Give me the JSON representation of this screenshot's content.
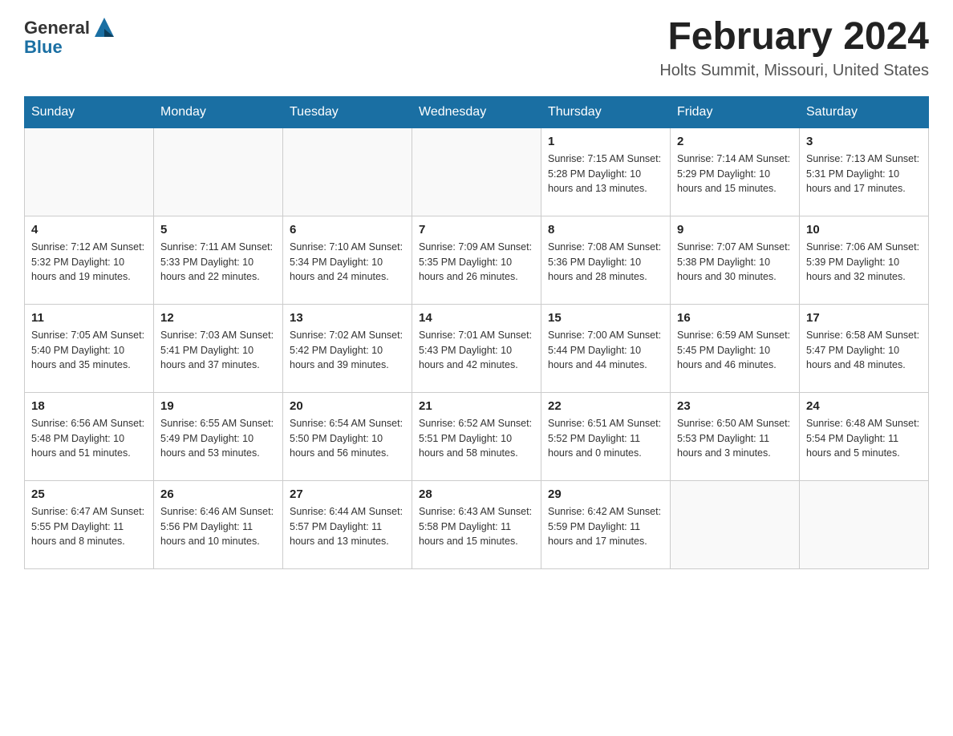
{
  "header": {
    "logo_text_general": "General",
    "logo_text_blue": "Blue",
    "month_title": "February 2024",
    "location": "Holts Summit, Missouri, United States"
  },
  "days_of_week": [
    "Sunday",
    "Monday",
    "Tuesday",
    "Wednesday",
    "Thursday",
    "Friday",
    "Saturday"
  ],
  "weeks": [
    [
      {
        "day": "",
        "info": ""
      },
      {
        "day": "",
        "info": ""
      },
      {
        "day": "",
        "info": ""
      },
      {
        "day": "",
        "info": ""
      },
      {
        "day": "1",
        "info": "Sunrise: 7:15 AM\nSunset: 5:28 PM\nDaylight: 10 hours\nand 13 minutes."
      },
      {
        "day": "2",
        "info": "Sunrise: 7:14 AM\nSunset: 5:29 PM\nDaylight: 10 hours\nand 15 minutes."
      },
      {
        "day": "3",
        "info": "Sunrise: 7:13 AM\nSunset: 5:31 PM\nDaylight: 10 hours\nand 17 minutes."
      }
    ],
    [
      {
        "day": "4",
        "info": "Sunrise: 7:12 AM\nSunset: 5:32 PM\nDaylight: 10 hours\nand 19 minutes."
      },
      {
        "day": "5",
        "info": "Sunrise: 7:11 AM\nSunset: 5:33 PM\nDaylight: 10 hours\nand 22 minutes."
      },
      {
        "day": "6",
        "info": "Sunrise: 7:10 AM\nSunset: 5:34 PM\nDaylight: 10 hours\nand 24 minutes."
      },
      {
        "day": "7",
        "info": "Sunrise: 7:09 AM\nSunset: 5:35 PM\nDaylight: 10 hours\nand 26 minutes."
      },
      {
        "day": "8",
        "info": "Sunrise: 7:08 AM\nSunset: 5:36 PM\nDaylight: 10 hours\nand 28 minutes."
      },
      {
        "day": "9",
        "info": "Sunrise: 7:07 AM\nSunset: 5:38 PM\nDaylight: 10 hours\nand 30 minutes."
      },
      {
        "day": "10",
        "info": "Sunrise: 7:06 AM\nSunset: 5:39 PM\nDaylight: 10 hours\nand 32 minutes."
      }
    ],
    [
      {
        "day": "11",
        "info": "Sunrise: 7:05 AM\nSunset: 5:40 PM\nDaylight: 10 hours\nand 35 minutes."
      },
      {
        "day": "12",
        "info": "Sunrise: 7:03 AM\nSunset: 5:41 PM\nDaylight: 10 hours\nand 37 minutes."
      },
      {
        "day": "13",
        "info": "Sunrise: 7:02 AM\nSunset: 5:42 PM\nDaylight: 10 hours\nand 39 minutes."
      },
      {
        "day": "14",
        "info": "Sunrise: 7:01 AM\nSunset: 5:43 PM\nDaylight: 10 hours\nand 42 minutes."
      },
      {
        "day": "15",
        "info": "Sunrise: 7:00 AM\nSunset: 5:44 PM\nDaylight: 10 hours\nand 44 minutes."
      },
      {
        "day": "16",
        "info": "Sunrise: 6:59 AM\nSunset: 5:45 PM\nDaylight: 10 hours\nand 46 minutes."
      },
      {
        "day": "17",
        "info": "Sunrise: 6:58 AM\nSunset: 5:47 PM\nDaylight: 10 hours\nand 48 minutes."
      }
    ],
    [
      {
        "day": "18",
        "info": "Sunrise: 6:56 AM\nSunset: 5:48 PM\nDaylight: 10 hours\nand 51 minutes."
      },
      {
        "day": "19",
        "info": "Sunrise: 6:55 AM\nSunset: 5:49 PM\nDaylight: 10 hours\nand 53 minutes."
      },
      {
        "day": "20",
        "info": "Sunrise: 6:54 AM\nSunset: 5:50 PM\nDaylight: 10 hours\nand 56 minutes."
      },
      {
        "day": "21",
        "info": "Sunrise: 6:52 AM\nSunset: 5:51 PM\nDaylight: 10 hours\nand 58 minutes."
      },
      {
        "day": "22",
        "info": "Sunrise: 6:51 AM\nSunset: 5:52 PM\nDaylight: 11 hours\nand 0 minutes."
      },
      {
        "day": "23",
        "info": "Sunrise: 6:50 AM\nSunset: 5:53 PM\nDaylight: 11 hours\nand 3 minutes."
      },
      {
        "day": "24",
        "info": "Sunrise: 6:48 AM\nSunset: 5:54 PM\nDaylight: 11 hours\nand 5 minutes."
      }
    ],
    [
      {
        "day": "25",
        "info": "Sunrise: 6:47 AM\nSunset: 5:55 PM\nDaylight: 11 hours\nand 8 minutes."
      },
      {
        "day": "26",
        "info": "Sunrise: 6:46 AM\nSunset: 5:56 PM\nDaylight: 11 hours\nand 10 minutes."
      },
      {
        "day": "27",
        "info": "Sunrise: 6:44 AM\nSunset: 5:57 PM\nDaylight: 11 hours\nand 13 minutes."
      },
      {
        "day": "28",
        "info": "Sunrise: 6:43 AM\nSunset: 5:58 PM\nDaylight: 11 hours\nand 15 minutes."
      },
      {
        "day": "29",
        "info": "Sunrise: 6:42 AM\nSunset: 5:59 PM\nDaylight: 11 hours\nand 17 minutes."
      },
      {
        "day": "",
        "info": ""
      },
      {
        "day": "",
        "info": ""
      }
    ]
  ]
}
